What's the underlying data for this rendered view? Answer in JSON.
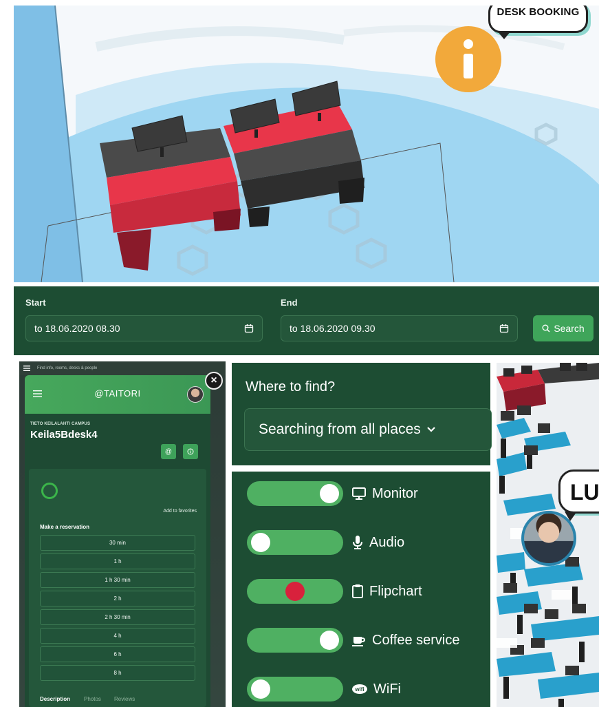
{
  "scene": {
    "bubble_text": "DESK BOOKING",
    "info_icon": "info-icon"
  },
  "booking": {
    "start_label": "Start",
    "start_value": "to 18.06.2020 08.30",
    "end_label": "End",
    "end_value": "to 18.06.2020 09.30",
    "search_label": "Search"
  },
  "mobile": {
    "search_placeholder": "Find info, rooms, desks & people",
    "brand": "@TAITORI",
    "campus": "TIETO KEILALAHTI CAMPUS",
    "desk_name": "Keila5Bdesk4",
    "add_favorites": "Add to favorites",
    "make_reservation": "Make a reservation",
    "durations": [
      "30 min",
      "1 h",
      "1 h 30 min",
      "2 h",
      "2 h 30 min",
      "4 h",
      "6 h",
      "8 h"
    ],
    "tabs": [
      "Description",
      "Photos",
      "Reviews"
    ],
    "close_label": "×"
  },
  "where": {
    "title": "Where to find?",
    "select_value": "Searching from all places"
  },
  "filters": [
    {
      "label": "Monitor",
      "state": "on",
      "icon": "monitor-icon"
    },
    {
      "label": "Audio",
      "state": "off",
      "icon": "microphone-icon"
    },
    {
      "label": "Flipchart",
      "state": "neutral",
      "icon": "clipboard-icon"
    },
    {
      "label": "Coffee service",
      "state": "on",
      "icon": "coffee-icon"
    },
    {
      "label": "WiFi",
      "state": "off",
      "icon": "wifi-icon"
    }
  ],
  "right_scene": {
    "bubble_text": "LU"
  },
  "colors": {
    "panel_green": "#1d4d33",
    "accent_green": "#3fa55a",
    "toggle_on": "#4fb062",
    "flipchart_dot": "#d8213c",
    "info_orange": "#f2a93b"
  }
}
